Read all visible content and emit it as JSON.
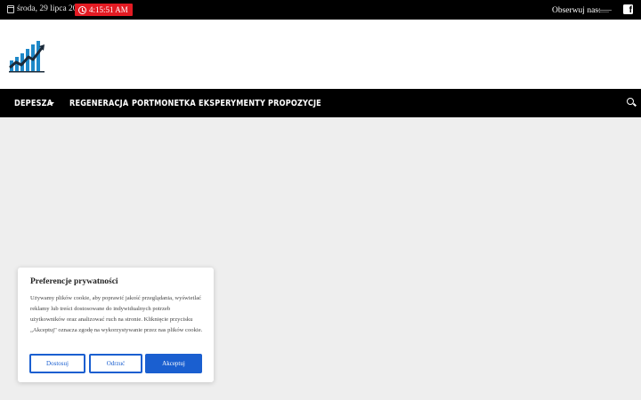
{
  "topbar": {
    "date": "środa, 29 lipca 2026",
    "time": "4:15:51 AM",
    "follow_label": "Obserwuj nas:",
    "icons": [
      "calendar-icon",
      "clock-icon",
      "facebook-icon"
    ]
  },
  "nav": {
    "items": [
      {
        "label": "DEPESZA",
        "has_dropdown": true
      },
      {
        "label": "REGENERACJA"
      },
      {
        "label": "PORTMONETKA"
      },
      {
        "label": "EKSPERYMENTY"
      },
      {
        "label": "PROPOZYCJE"
      }
    ],
    "search_icon": "search-icon"
  },
  "cookie": {
    "title": "Preferencje prywatności",
    "text": "Używamy plików cookie, aby poprawić jakość przeglądania, wyświetlać reklamy lub treści dostosowane do indywidualnych potrzeb użytkowników oraz analizować ruch na stronie. Kliknięcie przycisku „Akceptuj\" oznacza zgodę na wykorzystywanie przez nas plików cookie.",
    "buttons": {
      "customize": "Dostosuj",
      "reject": "Odrzuć",
      "accept": "Akceptuj"
    }
  },
  "colors": {
    "topbar_bg": "#000000",
    "time_badge": "#e31b23",
    "nav_bg": "#000000",
    "page_bg": "#eeeeee",
    "button_blue": "#1a5fd0",
    "logo_blue": "#1e88c8"
  }
}
